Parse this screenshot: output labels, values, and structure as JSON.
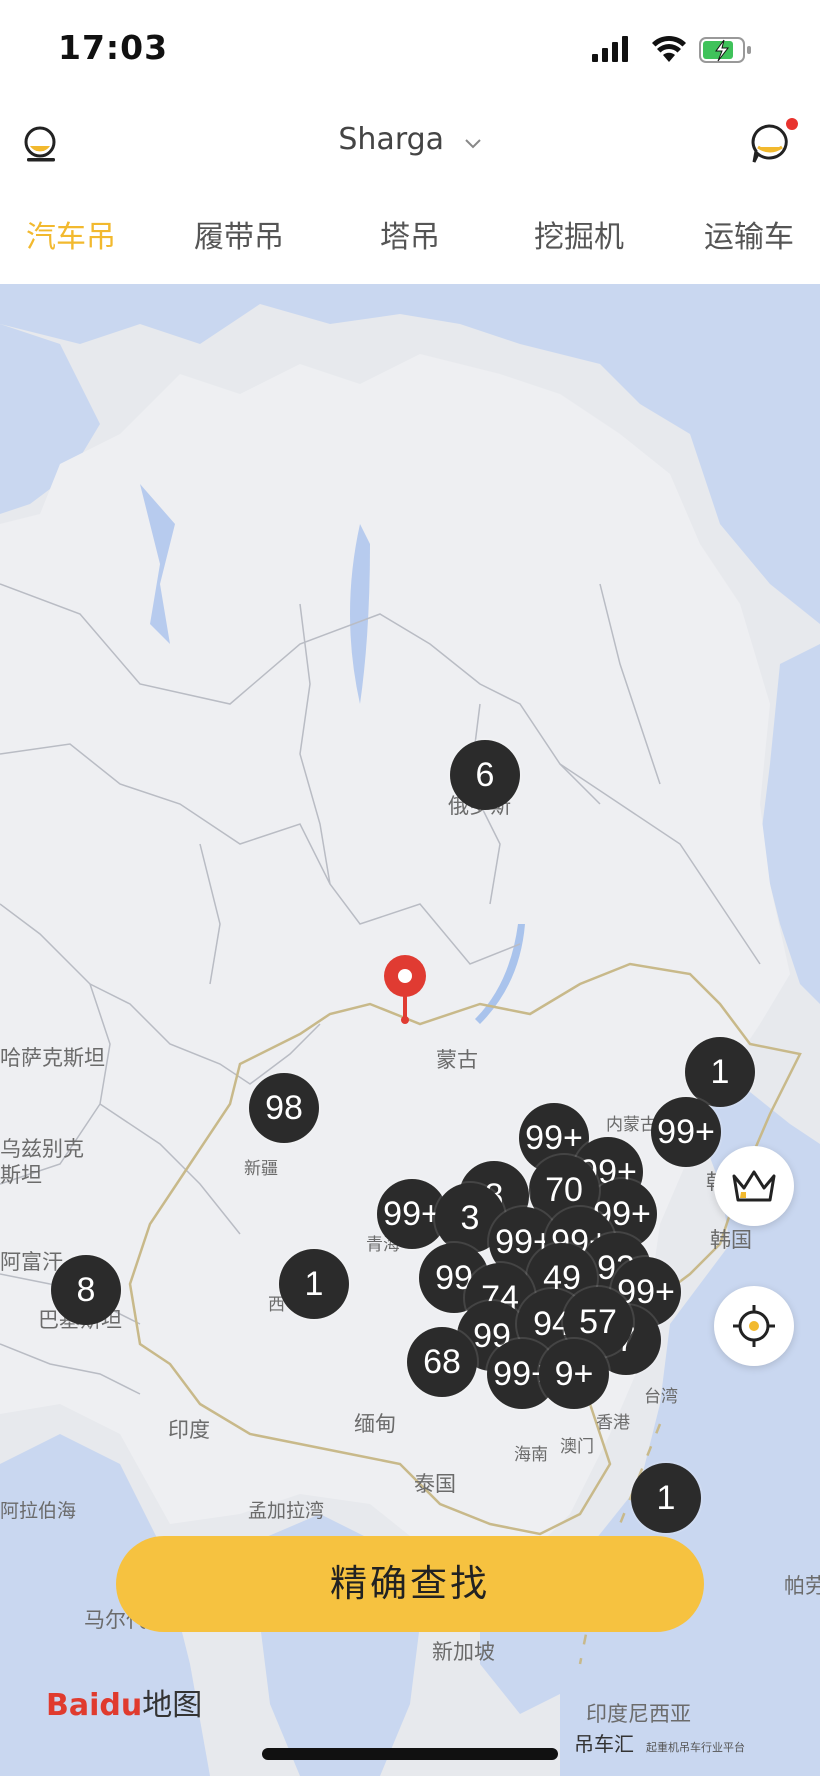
{
  "status_bar": {
    "time": "17:03",
    "battery_charging": true
  },
  "header": {
    "city": "Sharga",
    "has_notification": true,
    "accent_color": "#f2b92e"
  },
  "tabs": [
    {
      "label": "汽车吊",
      "active": true
    },
    {
      "label": "履带吊",
      "active": false
    },
    {
      "label": "塔吊",
      "active": false
    },
    {
      "label": "挖掘机",
      "active": false
    },
    {
      "label": "运输车",
      "active": false
    }
  ],
  "map": {
    "labels": {
      "kazakhstan": "哈萨克斯坦",
      "uzbekistan": "乌兹别克\n斯坦",
      "afghanistan": "阿富汗",
      "pakistan": "巴基斯坦",
      "mongolia": "蒙古",
      "xinjiang": "新疆",
      "qinghai": "青海",
      "tibet": "西",
      "inner_mongolia": "内蒙古",
      "korea": "韩国",
      "north_korea": "朝鲜",
      "india": "印度",
      "myanmar": "缅甸",
      "thailand": "泰国",
      "bangladesh": "孟加拉湾",
      "arabian_sea": "阿拉伯海",
      "maldives": "马尔代夫",
      "singapore": "新加坡",
      "indonesia": "印度尼西亚",
      "hainan": "海南",
      "macau": "澳门",
      "hongkong": "香港",
      "taiwan": "台湾",
      "palau": "帕劳",
      "russia_hint": "俄罗斯"
    },
    "clusters": {
      "c_russia": "6",
      "c_xinjiang": "98",
      "c_tibet": "1",
      "c_pakistan": "8",
      "c_ne1": "1",
      "c_ne2": "99+",
      "c_north1": "99+",
      "c_north2": "99+",
      "c_north3": "99+",
      "c_70": "70",
      "c_west1": "99+",
      "c_3": "3",
      "c_8": "8",
      "c_mid1": "99+",
      "c_mid2": "99+",
      "c_49": "49",
      "c_99a": "99",
      "c_74": "74",
      "c_92": "92",
      "c_east": "99+",
      "c_94": "94",
      "c_57": "57",
      "c_7": "7",
      "c_99b": "99",
      "c_68": "68",
      "c_s1": "99+",
      "c_s2": "9+",
      "c_phil": "1"
    },
    "current_location_pin": true
  },
  "search_button": {
    "label": "精确查找",
    "color": "#f6c240"
  },
  "footer": {
    "baidu_logo": "Baidu",
    "baidu_du": "du",
    "baidu_map_word": "地图",
    "brand": "吊车汇",
    "brand_tagline": "起重机吊车行业平台"
  }
}
